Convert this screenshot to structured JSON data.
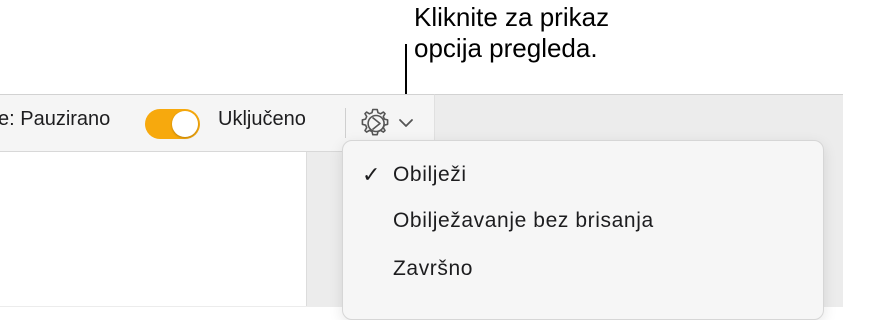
{
  "callout": {
    "line1": "Kliknite za prikaz",
    "line2": "opcija pregleda."
  },
  "toolbar": {
    "status_label": "e: Pauzirano",
    "toggle_state_label": "Uključeno",
    "toggle_on": true,
    "accent_color": "#f7a90d",
    "view_options_icon": "gear-icon"
  },
  "menu": {
    "items": [
      {
        "label": "Obilježi",
        "checked": true
      },
      {
        "label": "Obilježavanje bez brisanja",
        "checked": false
      },
      {
        "label": "Završno",
        "checked": false
      }
    ]
  }
}
